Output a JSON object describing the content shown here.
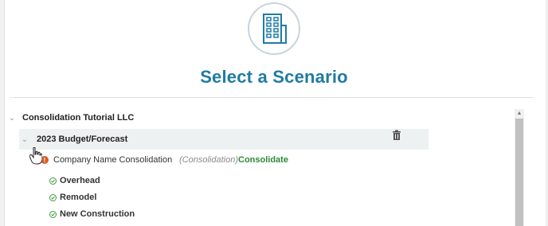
{
  "header": {
    "logo_icon": "building-icon",
    "title": "Select a Scenario"
  },
  "tree": {
    "organization": {
      "label": "Consolidation Tutorial LLC",
      "expanded": true
    },
    "budget": {
      "label": "2023 Budget/Forecast",
      "expanded": true,
      "delete_icon": "trash-icon"
    },
    "consolidation": {
      "name": "Company Name Consolidation",
      "type": "(Consolidation)",
      "action": "Consolidate",
      "status_icon": "alert-icon",
      "alert_glyph": "!"
    },
    "children": [
      {
        "label": "Overhead",
        "status_icon": "check-circle-icon"
      },
      {
        "label": "Remodel",
        "status_icon": "check-circle-icon"
      },
      {
        "label": "New Construction",
        "status_icon": "check-circle-icon"
      }
    ]
  },
  "colors": {
    "title": "#1f7ba3",
    "action_green": "#2e8a36",
    "alert_orange": "#d95b2b",
    "row_highlight": "#eef1f2"
  }
}
